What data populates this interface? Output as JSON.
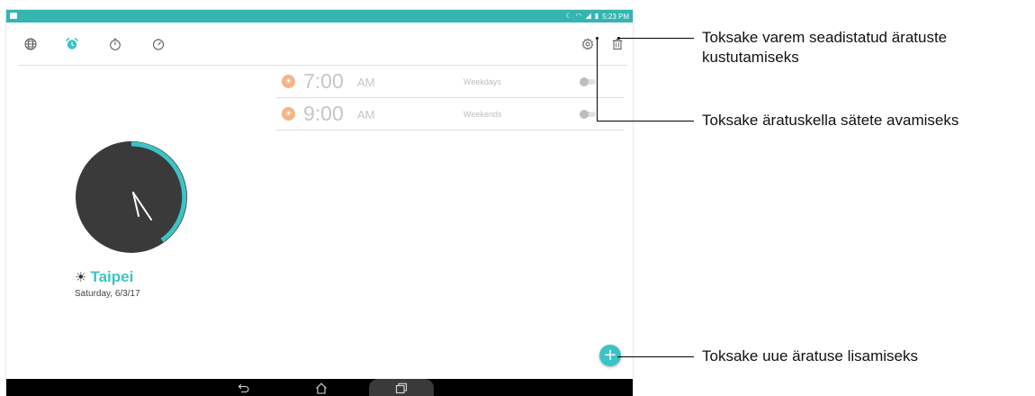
{
  "status_bar": {
    "time": "5:23 PM",
    "icons": [
      "moon-icon",
      "wifi-icon",
      "signal-icon",
      "battery-charging-icon"
    ]
  },
  "toolbar": {
    "tabs": [
      {
        "name": "world-clock-tab",
        "icon": "globe-icon",
        "active": false
      },
      {
        "name": "alarm-tab",
        "icon": "alarm-clock-icon",
        "active": true
      },
      {
        "name": "stopwatch-tab",
        "icon": "stopwatch-icon",
        "active": false
      },
      {
        "name": "timer-tab",
        "icon": "timer-icon",
        "active": false
      }
    ],
    "actions": [
      "settings-gear-icon",
      "trash-icon"
    ],
    "accent_color": "#3cc3c5"
  },
  "alarms": [
    {
      "time": "7:00",
      "ampm": "AM",
      "repeat": "Weekdays",
      "enabled": false
    },
    {
      "time": "9:00",
      "ampm": "AM",
      "repeat": "Weekends",
      "enabled": false
    }
  ],
  "world_clock": {
    "city": "Taipei",
    "date": "Saturday, 6/3/17",
    "face_color": "#3a3a3a",
    "arc_color": "#3cc3c5"
  },
  "fab": {
    "label": "+"
  },
  "callouts": {
    "delete_line1": "Toksake varem seadistatud äratuste",
    "delete_line2": "kustutamiseks",
    "settings": "Toksake äratuskella sätete avamiseks",
    "add": "Toksake uue äratuse lisamiseks"
  }
}
